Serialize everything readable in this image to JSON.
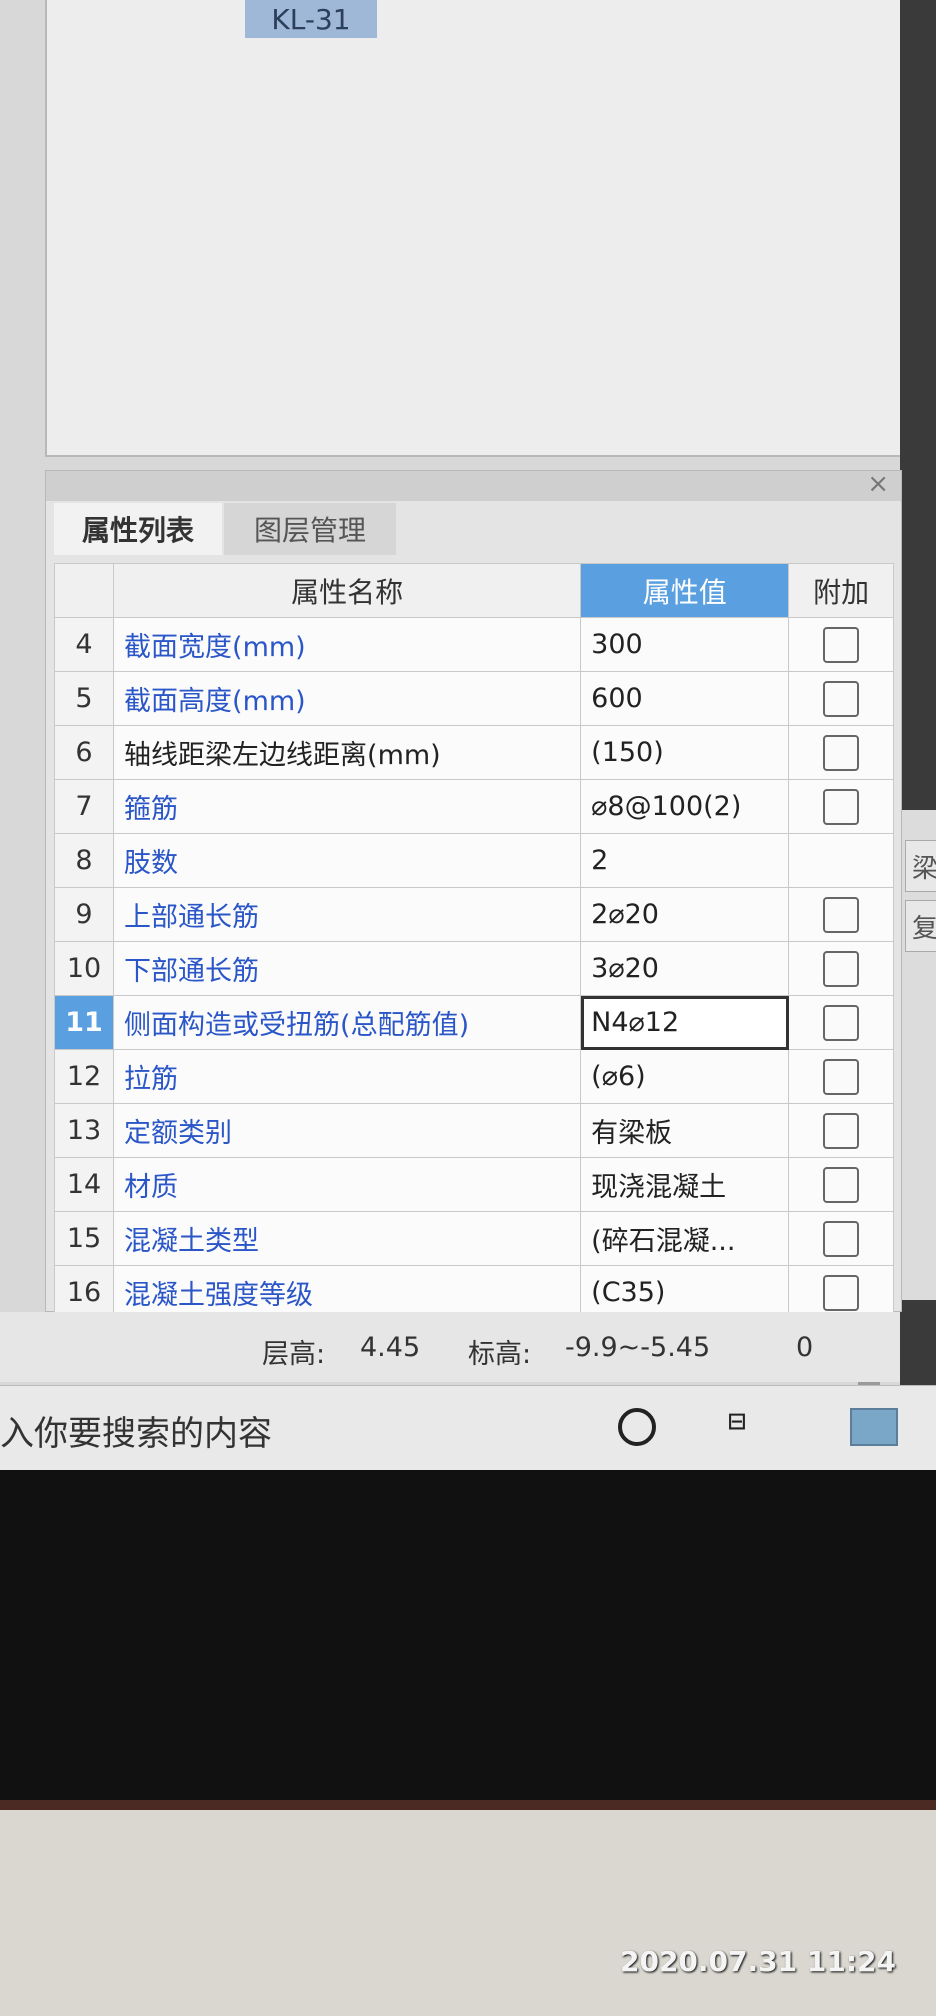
{
  "canvas": {
    "element_tag": "KL-31"
  },
  "panel": {
    "tabs": [
      {
        "label": "属性列表",
        "active": true
      },
      {
        "label": "图层管理",
        "active": false
      }
    ],
    "columns": {
      "index": "",
      "name": "属性名称",
      "value": "属性值",
      "extra": "附加"
    },
    "rows": [
      {
        "index": "4",
        "name": "截面宽度(mm)",
        "value": "300",
        "name_color": "blue",
        "has_checkbox": true
      },
      {
        "index": "5",
        "name": "截面高度(mm)",
        "value": "600",
        "name_color": "blue",
        "has_checkbox": true
      },
      {
        "index": "6",
        "name": "轴线距梁左边线距离(mm)",
        "value": "(150)",
        "name_color": "black",
        "has_checkbox": true
      },
      {
        "index": "7",
        "name": "箍筋",
        "value": "⌀8@100(2)",
        "name_color": "blue",
        "has_checkbox": true
      },
      {
        "index": "8",
        "name": "肢数",
        "value": "2",
        "name_color": "blue",
        "has_checkbox": false
      },
      {
        "index": "9",
        "name": "上部通长筋",
        "value": "2⌀20",
        "name_color": "blue",
        "has_checkbox": true
      },
      {
        "index": "10",
        "name": "下部通长筋",
        "value": "3⌀20",
        "name_color": "blue",
        "has_checkbox": true
      },
      {
        "index": "11",
        "name": "侧面构造或受扭筋(总配筋值)",
        "value": "N4⌀12",
        "name_color": "blue",
        "has_checkbox": true,
        "active": true
      },
      {
        "index": "12",
        "name": "拉筋",
        "value": "(⌀6)",
        "name_color": "blue",
        "has_checkbox": true
      },
      {
        "index": "13",
        "name": "定额类别",
        "value": "有梁板",
        "name_color": "blue",
        "has_checkbox": true
      },
      {
        "index": "14",
        "name": "材质",
        "value": "现浇混凝土",
        "name_color": "blue",
        "has_checkbox": true
      },
      {
        "index": "15",
        "name": "混凝土类型",
        "value": "(碎石混凝...",
        "name_color": "blue",
        "has_checkbox": true
      },
      {
        "index": "16",
        "name": "混凝土强度等级",
        "value": "(C35)",
        "name_color": "blue",
        "has_checkbox": true
      }
    ]
  },
  "status": {
    "floor_height_label": "层高:",
    "floor_height_value": "4.45",
    "elevation_label": "标高:",
    "elevation_value": "-9.9~-5.45",
    "extra_value": "0"
  },
  "taskbar": {
    "search_placeholder": "入你要搜索的内容"
  },
  "photo": {
    "timestamp": "2020.07.31 11:24"
  },
  "right_fragment": {
    "btn1": "梁",
    "btn2": "复"
  },
  "colors": {
    "accent": "#5aa0e0",
    "link_text": "#2a56c8"
  }
}
